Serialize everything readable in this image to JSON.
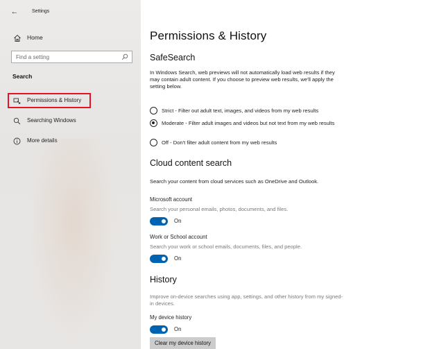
{
  "window": {
    "title": "Settings"
  },
  "sidebar": {
    "home_label": "Home",
    "search_placeholder": "Find a setting",
    "section_title": "Search",
    "items": [
      {
        "label": "Permissions & History",
        "icon": "permissions-icon",
        "selected": true
      },
      {
        "label": "Searching Windows",
        "icon": "search-icon",
        "selected": false
      },
      {
        "label": "More details",
        "icon": "info-icon",
        "selected": false
      }
    ]
  },
  "main": {
    "title": "Permissions & History",
    "safesearch": {
      "heading": "SafeSearch",
      "description": "In Windows Search, web previews will not automatically load web results if they may contain adult content. If you choose to preview web results, we'll apply the setting below.",
      "options": [
        {
          "label": "Strict - Filter out adult text, images, and videos from my web results",
          "checked": false
        },
        {
          "label": "Moderate - Filter adult images and videos but not text from my web results",
          "checked": true
        },
        {
          "label": "Off - Don't filter adult content from my web results",
          "checked": false
        }
      ]
    },
    "cloud": {
      "heading": "Cloud content search",
      "description": "Search your content from cloud services such as OneDrive and Outlook.",
      "microsoft_account": {
        "label": "Microsoft account",
        "description": "Search your personal emails, photos, documents, and files.",
        "state": "On"
      },
      "work_account": {
        "label": "Work or School account",
        "description": "Search your work or school emails, documents, files, and people.",
        "state": "On"
      }
    },
    "history": {
      "heading": "History",
      "description": "Improve on-device searches using app, settings, and other history from my signed-in devices.",
      "device_history": {
        "label": "My device history",
        "state": "On"
      },
      "clear_button": "Clear my device history"
    }
  },
  "colors": {
    "accent": "#0063b1",
    "highlight_box": "#e81123",
    "sidebar_bg": "#e9e7e5"
  }
}
